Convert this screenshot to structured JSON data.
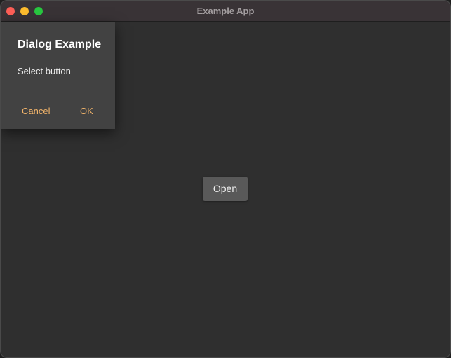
{
  "window": {
    "title": "Example App",
    "controls": {
      "close": "close-icon",
      "minimize": "minimize-icon",
      "zoom": "zoom-icon"
    }
  },
  "main": {
    "open_label": "Open"
  },
  "dialog": {
    "title": "Dialog Example",
    "message": "Select button",
    "cancel_label": "Cancel",
    "ok_label": "OK"
  },
  "colors": {
    "background": "#2f2f2f",
    "dialog_surface": "#424242",
    "accent": "#f2b46a",
    "button_surface": "#595959"
  }
}
